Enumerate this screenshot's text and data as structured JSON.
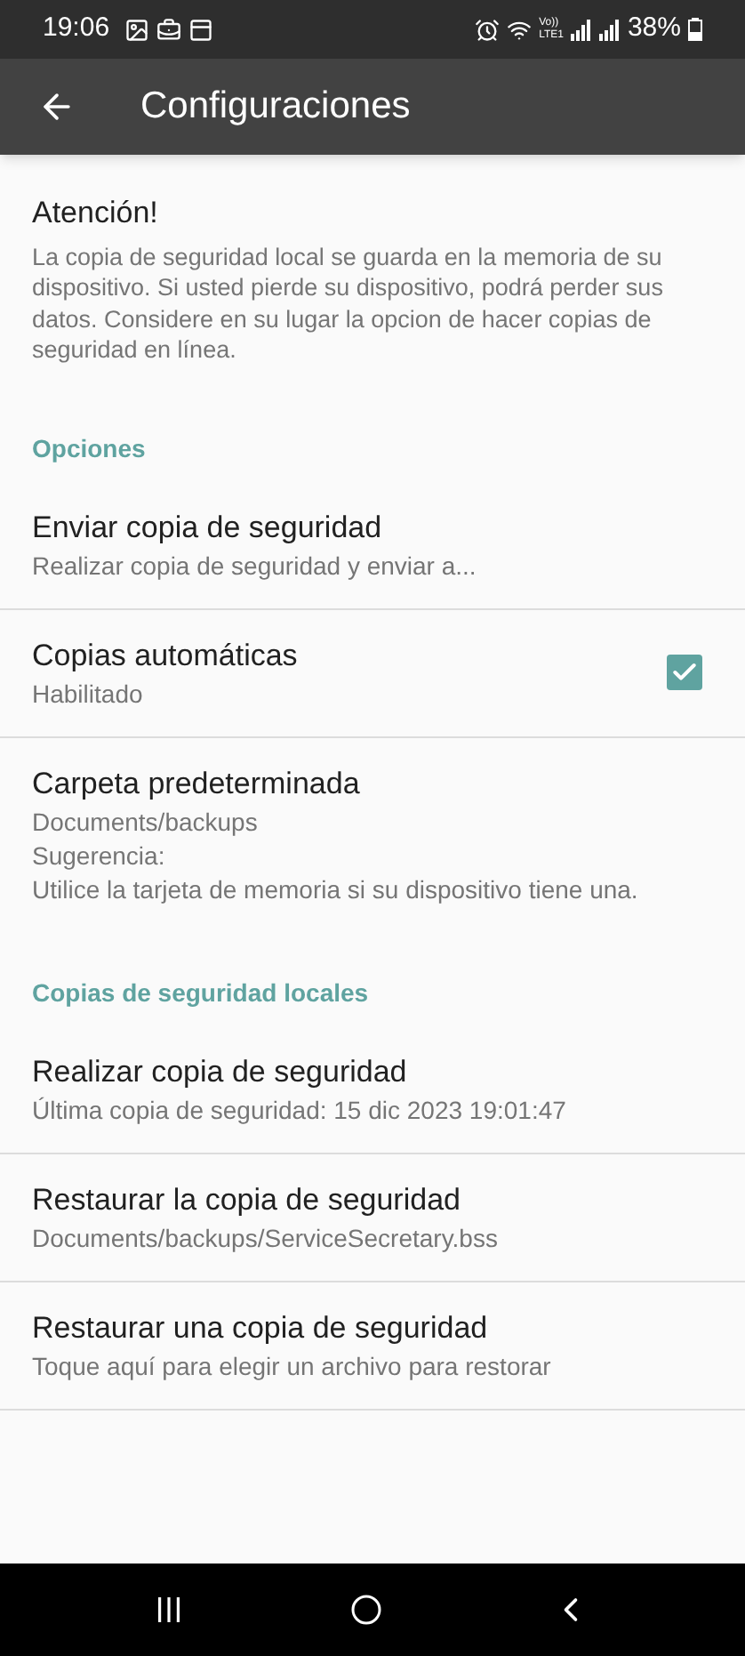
{
  "status_bar": {
    "time": "19:06",
    "network": "Vo))\nLTE1",
    "battery": "38%"
  },
  "app_bar": {
    "title": "Configuraciones"
  },
  "notice": {
    "title": "Atención!",
    "text": "La copia de seguridad local se guarda en la memoria de su dispositivo. Si usted pierde su dispositivo, podrá perder sus datos. Considere en su lugar la opcion de hacer copias de seguridad en línea."
  },
  "sections": [
    {
      "header": "Opciones",
      "items": [
        {
          "kind": "plain",
          "title": "Enviar copia de seguridad",
          "summary": [
            "Realizar copia de seguridad y enviar a..."
          ]
        },
        {
          "kind": "checkbox",
          "title": "Copias automáticas",
          "summary": [
            "Habilitado"
          ],
          "checked": true
        },
        {
          "kind": "plain",
          "title": "Carpeta predeterminada",
          "summary": [
            "Documents/backups",
            "Sugerencia:",
            "Utilice la tarjeta de memoria si su dispositivo tiene una."
          ]
        }
      ]
    },
    {
      "header": "Copias de seguridad locales",
      "items": [
        {
          "kind": "plain",
          "title": "Realizar copia de seguridad",
          "summary": [
            "Última copia de seguridad: 15 dic 2023 19:01:47"
          ]
        },
        {
          "kind": "plain",
          "title": "Restaurar la copia de seguridad",
          "summary": [
            "Documents/backups/ServiceSecretary.bss"
          ]
        },
        {
          "kind": "plain",
          "title": "Restaurar una copia de seguridad",
          "summary": [
            "Toque aquí para elegir un archivo para restorar"
          ]
        }
      ]
    }
  ]
}
